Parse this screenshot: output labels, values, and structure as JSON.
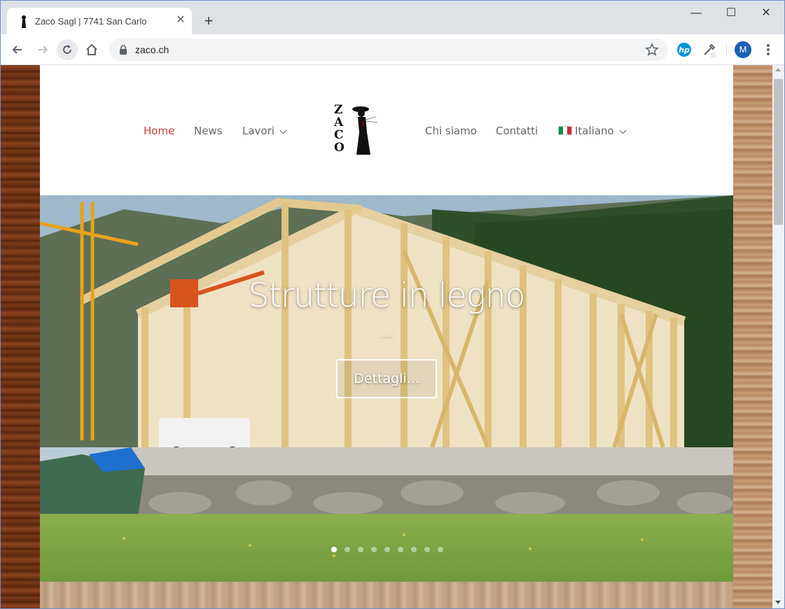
{
  "browser": {
    "tab_title": "Zaco Sagl | 7741 San Carlo",
    "url": "zaco.ch",
    "profile_initial": "M"
  },
  "site": {
    "nav": {
      "home": "Home",
      "news": "News",
      "lavori": "Lavori",
      "chi_siamo": "Chi siamo",
      "contatti": "Contatti",
      "language": "Italiano"
    },
    "logo_letters": [
      "Z",
      "A",
      "C",
      "O"
    ],
    "active_nav_color": "#d23d3d"
  },
  "hero": {
    "title": "Strutture in legno",
    "subtitle": "...",
    "button_label": "Dettagli...",
    "slide_count": 9,
    "active_slide": 1
  }
}
